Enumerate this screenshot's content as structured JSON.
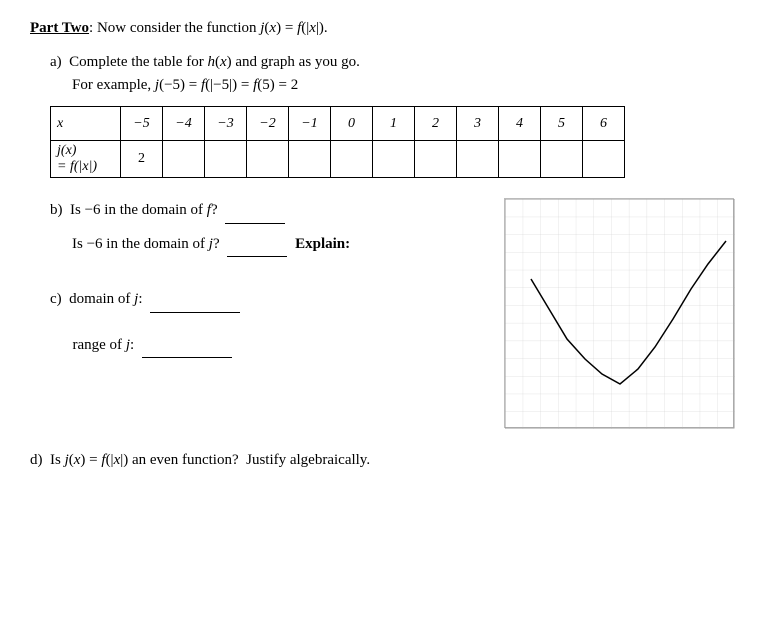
{
  "part": {
    "label": "Part Two",
    "colon": ":",
    "intro": "Now consider the function ",
    "function_def": "j(x) = f(|x|)."
  },
  "instruction_a": {
    "line1": "Complete the table for h(x) and graph as you go.",
    "line2": "For example, j(−5) = f(|−5|) = f(5) = 2"
  },
  "table": {
    "x_label": "x",
    "col_headers": [
      "−5",
      "−4",
      "−3",
      "−2",
      "−1",
      "0",
      "1",
      "2",
      "3",
      "4",
      "5",
      "6"
    ],
    "row_label": "j(x)\n= f(|x|)",
    "row_values": [
      "2",
      "",
      "",
      "",
      "",
      "",
      "",
      "",
      "",
      "",
      "",
      ""
    ]
  },
  "question_b": {
    "label_b": "b)",
    "text1": "Is −6 in the domain of ",
    "f_italic": "f",
    "q1_end": "?",
    "text2": "Is −6 in the domain of ",
    "j_italic": "j",
    "q2_end": "?",
    "explain": "Explain:"
  },
  "question_c": {
    "label": "c)",
    "domain_text": "domain of j:",
    "range_text": "range of j:"
  },
  "question_d": {
    "label": "d)",
    "text": "Is j(x) = f(|x|) an even function?  Justify algebraically."
  },
  "graph": {
    "grid_size": 230,
    "cols": 13,
    "rows": 13
  }
}
